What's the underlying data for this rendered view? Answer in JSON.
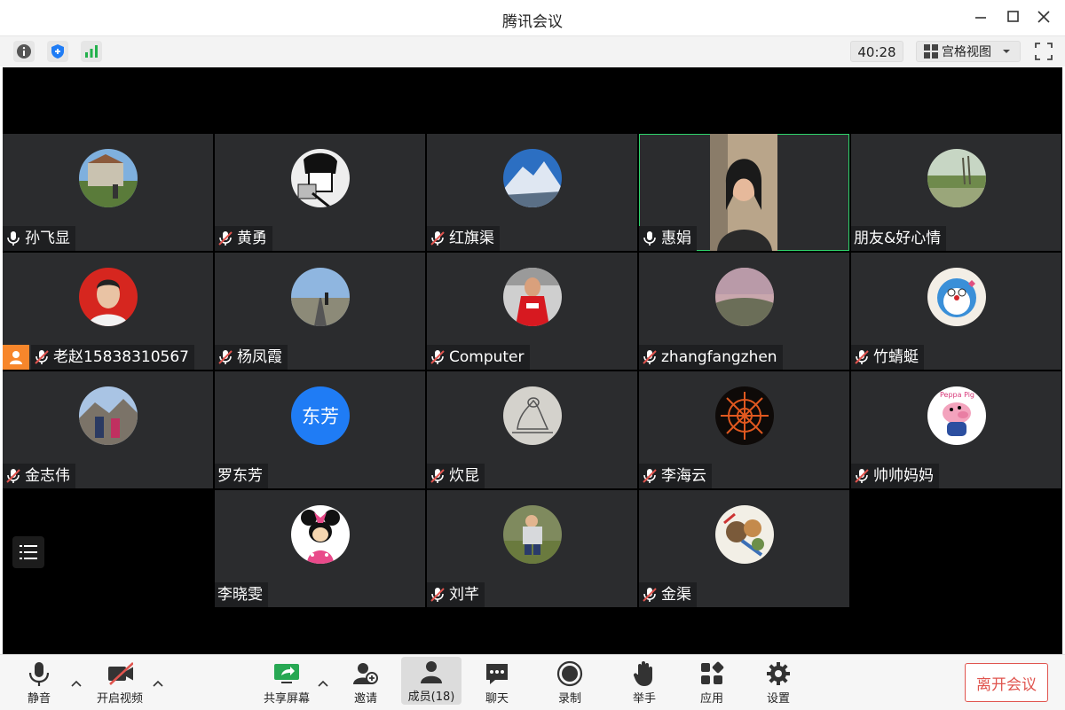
{
  "window": {
    "title": "腾讯会议"
  },
  "toolbar": {
    "timer": "40:28",
    "view_mode": "宫格视图"
  },
  "participants": [
    {
      "name": "孙飞显",
      "muted": false
    },
    {
      "name": "黄勇",
      "muted": true
    },
    {
      "name": "红旗渠",
      "muted": true
    },
    {
      "name": "惠娟",
      "muted": false
    },
    {
      "name": "朋友&好心情",
      "muted": null
    },
    {
      "name": "老赵15838310567",
      "muted": true
    },
    {
      "name": "杨凤霞",
      "muted": true
    },
    {
      "name": "Computer",
      "muted": true
    },
    {
      "name": "zhangfangzhen",
      "muted": true
    },
    {
      "name": "竹蜻蜓",
      "muted": true
    },
    {
      "name": "金志伟",
      "muted": true
    },
    {
      "name": "罗东芳",
      "muted": null,
      "avatar_text": "东芳"
    },
    {
      "name": "炊昆",
      "muted": true
    },
    {
      "name": "李海云",
      "muted": true
    },
    {
      "name": "帅帅妈妈",
      "muted": true
    },
    {
      "name": "李晓雯",
      "muted": null
    },
    {
      "name": "刘芊",
      "muted": true
    },
    {
      "name": "金渠",
      "muted": true
    }
  ],
  "bottom": {
    "mute": "静音",
    "video": "开启视频",
    "share": "共享屏幕",
    "invite": "邀请",
    "members": "成员(18)",
    "chat": "聊天",
    "record": "录制",
    "raise_hand": "举手",
    "apps": "应用",
    "settings": "设置",
    "leave": "离开会议"
  },
  "colors": {
    "active_speaker": "#2fd36b",
    "leave": "#e0544e",
    "host_badge": "#f7862b",
    "tile_bg": "#2b2c2e"
  }
}
